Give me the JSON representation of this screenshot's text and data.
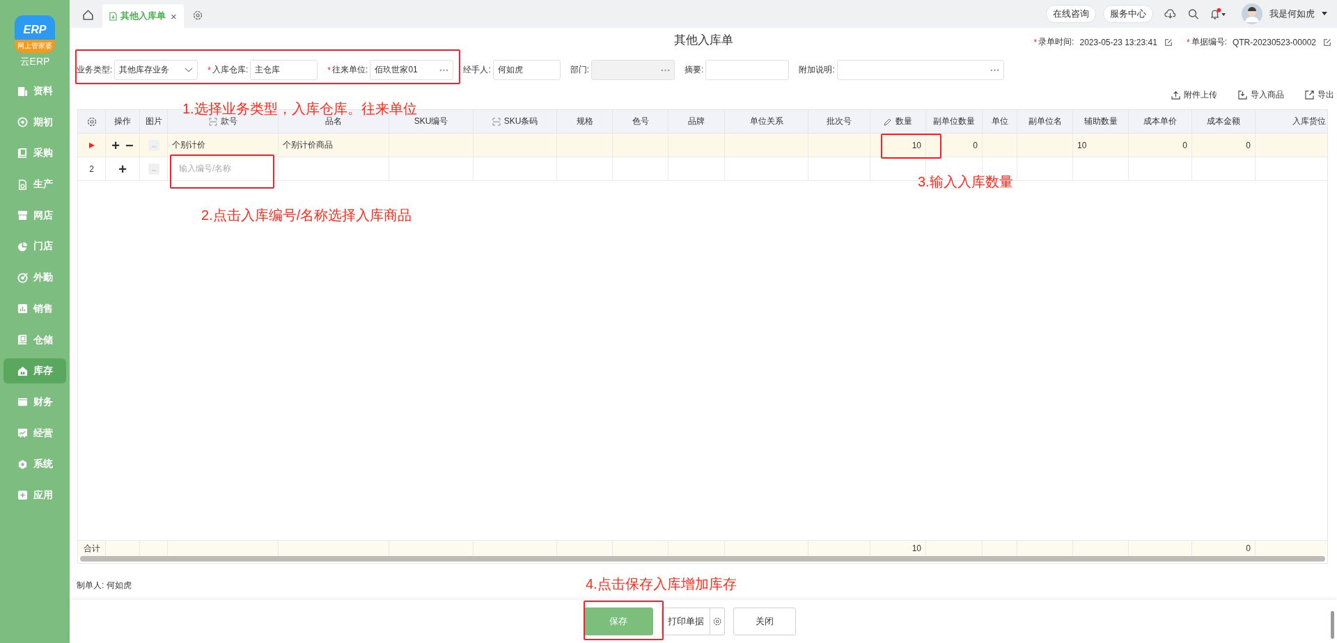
{
  "sidebar": {
    "logo": {
      "mark": "ERP",
      "badge": "网上管家婆",
      "name": "云ERP"
    },
    "items": [
      {
        "label": "资料",
        "selected": false
      },
      {
        "label": "期初",
        "selected": false
      },
      {
        "label": "采购",
        "selected": false
      },
      {
        "label": "生产",
        "selected": false
      },
      {
        "label": "网店",
        "selected": false
      },
      {
        "label": "门店",
        "selected": false
      },
      {
        "label": "外勤",
        "selected": false
      },
      {
        "label": "销售",
        "selected": false
      },
      {
        "label": "仓储",
        "selected": false
      },
      {
        "label": "库存",
        "selected": true
      },
      {
        "label": "财务",
        "selected": false
      },
      {
        "label": "经营",
        "selected": false
      },
      {
        "label": "系统",
        "selected": false
      },
      {
        "label": "应用",
        "selected": false
      }
    ]
  },
  "tabs": [
    {
      "label": "其他入库单",
      "selected": true,
      "close": "×"
    }
  ],
  "header": {
    "links": [
      "在线咨询",
      "服务中心"
    ],
    "notification": true,
    "user": "我是何如虎"
  },
  "page": {
    "title": "其他入库单",
    "meta": [
      {
        "mark": "*",
        "label": "录单时间:",
        "value": "2023-05-23 13:23:41"
      },
      {
        "mark": "*",
        "label": "单据编号:",
        "value": "QTR-20230523-00002"
      }
    ]
  },
  "form": [
    {
      "label": "业务类型:",
      "kind": "select",
      "value": "其他库存业务",
      "disabled": false
    },
    {
      "mark": "*",
      "label": "入库仓库:",
      "kind": "input",
      "value": "主仓库",
      "disabled": false
    },
    {
      "mark": "*",
      "label": "往来单位:",
      "kind": "lookup",
      "value": "佰玖世家01",
      "disabled": false
    },
    {
      "label": "经手人:",
      "kind": "input",
      "value": "何如虎",
      "disabled": false
    },
    {
      "label": "部门:",
      "kind": "lookup",
      "disabled": true
    },
    {
      "label": "摘要:",
      "kind": "input",
      "disabled": false
    },
    {
      "label": "附加说明:",
      "kind": "lookup",
      "disabled": false
    }
  ],
  "toolbar": [
    "附件上传",
    "导入商品",
    "导出"
  ],
  "table": {
    "columns": [
      {
        "label": "操作",
        "kind": "plain"
      },
      {
        "label": "图片",
        "kind": "plain"
      },
      {
        "label": "款号",
        "kind": "code"
      },
      {
        "label": "品名",
        "kind": "plain"
      },
      {
        "label": "SKU编号",
        "kind": "plain"
      },
      {
        "label": "SKU条码",
        "kind": "code"
      },
      {
        "label": "规格",
        "kind": "plain"
      },
      {
        "label": "色号",
        "kind": "plain"
      },
      {
        "label": "品牌",
        "kind": "plain"
      },
      {
        "label": "单位关系",
        "kind": "plain"
      },
      {
        "label": "批次号",
        "kind": "plain"
      },
      {
        "label": "数量",
        "kind": "editable"
      },
      {
        "label": "副单位数量",
        "kind": "plain"
      },
      {
        "label": "单位",
        "kind": "plain"
      },
      {
        "label": "副单位名",
        "kind": "plain"
      },
      {
        "label": "辅助数量",
        "kind": "plain"
      },
      {
        "label": "成本单价",
        "kind": "plain"
      },
      {
        "label": "成本金额",
        "kind": "plain"
      },
      {
        "label": "入库货位",
        "kind": "plain"
      }
    ],
    "rows": [
      {
        "selected": true,
        "actions": [
          "+",
          "−"
        ],
        "cells": [
          {
            "kind": "text",
            "text": "个别计价"
          },
          {
            "kind": "text",
            "text": "个别计价商品"
          },
          {
            "kind": "empty"
          },
          {
            "kind": "empty"
          },
          {
            "kind": "empty"
          },
          {
            "kind": "empty"
          },
          {
            "kind": "empty"
          },
          {
            "kind": "empty"
          },
          {
            "kind": "empty"
          },
          {
            "kind": "text",
            "text": "10"
          },
          {
            "kind": "text",
            "text": "0"
          },
          {
            "kind": "empty"
          },
          {
            "kind": "empty"
          },
          {
            "kind": "text",
            "text": "10"
          },
          {
            "kind": "text",
            "text": "0"
          },
          {
            "kind": "text",
            "text": "0"
          },
          {
            "kind": "empty"
          }
        ]
      },
      {
        "selected": false,
        "number": "2",
        "actions": [
          "+"
        ],
        "cells": [
          {
            "kind": "input",
            "placeholder": "输入编号/名称"
          },
          {
            "kind": "empty"
          },
          {
            "kind": "empty"
          },
          {
            "kind": "empty"
          },
          {
            "kind": "empty"
          },
          {
            "kind": "empty"
          },
          {
            "kind": "empty"
          },
          {
            "kind": "empty"
          },
          {
            "kind": "empty"
          },
          {
            "kind": "empty"
          },
          {
            "kind": "empty"
          },
          {
            "kind": "empty"
          },
          {
            "kind": "empty"
          },
          {
            "kind": "empty"
          },
          {
            "kind": "empty"
          },
          {
            "kind": "empty"
          },
          {
            "kind": "empty"
          }
        ]
      }
    ],
    "total": {
      "label": "合计",
      "cells": [
        {
          "kind": "empty"
        },
        {
          "kind": "empty"
        },
        {
          "kind": "empty"
        },
        {
          "kind": "empty"
        },
        {
          "kind": "empty"
        },
        {
          "kind": "empty"
        },
        {
          "kind": "empty"
        },
        {
          "kind": "empty"
        },
        {
          "kind": "empty"
        },
        {
          "kind": "text",
          "text": "10"
        },
        {
          "kind": "empty"
        },
        {
          "kind": "empty"
        },
        {
          "kind": "empty"
        },
        {
          "kind": "empty"
        },
        {
          "kind": "empty"
        },
        {
          "kind": "text",
          "text": "0"
        },
        {
          "kind": "empty"
        }
      ]
    }
  },
  "creator": "制单人: 何如虎",
  "buttons": [
    {
      "label": "保存",
      "kind": "primary"
    },
    {
      "label": "打印单据",
      "kind": "split"
    },
    {
      "label": "关闭",
      "kind": "default"
    }
  ],
  "annotations": [
    {
      "kind": "box"
    },
    {
      "kind": "box"
    },
    {
      "kind": "box"
    },
    {
      "kind": "box"
    },
    {
      "kind": "note",
      "text": "1.选择业务类型，入库仓库。往来单位"
    },
    {
      "kind": "note",
      "text": "2.点击入库编号/名称选择入库商品"
    },
    {
      "kind": "note",
      "text": "3.输入入库数量"
    },
    {
      "kind": "note",
      "text": "4.点击保存入库增加库存"
    }
  ]
}
